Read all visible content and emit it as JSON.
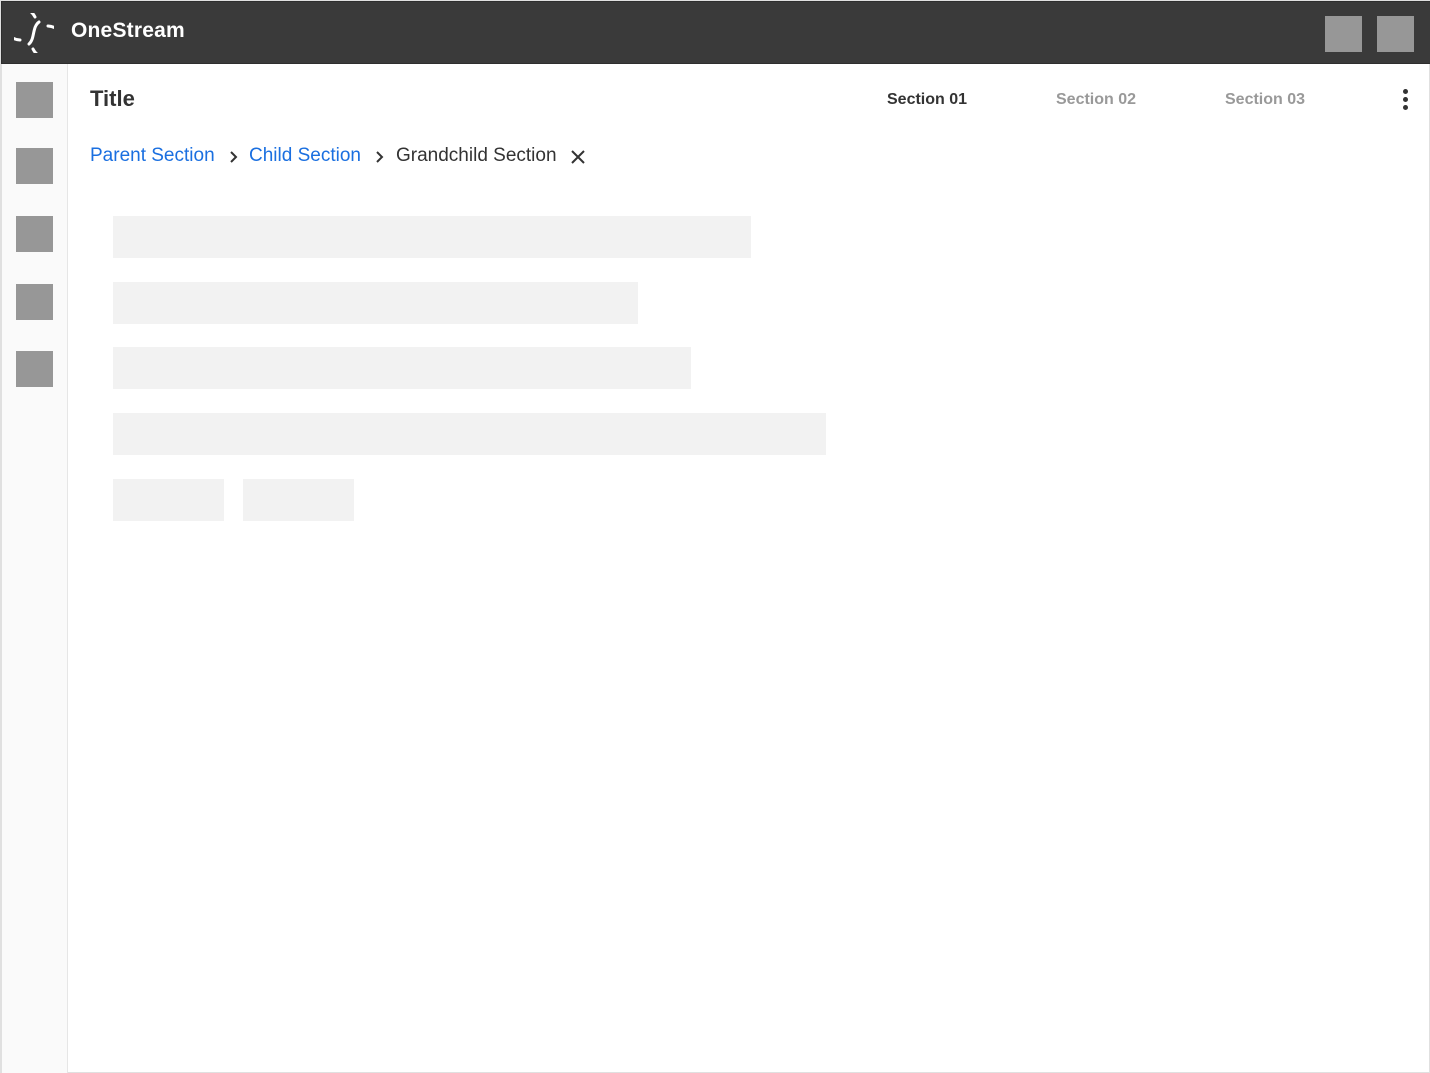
{
  "app": {
    "name": "OneStream",
    "logo_icon": "onestream-logo-icon"
  },
  "topbar": {
    "actions": [
      "placeholder-icon",
      "placeholder-icon"
    ]
  },
  "sidebar": {
    "items": [
      "placeholder-icon",
      "placeholder-icon",
      "placeholder-icon",
      "placeholder-icon",
      "placeholder-icon"
    ]
  },
  "header": {
    "title": "Title",
    "tabs": [
      {
        "label": "Section 01",
        "active": true
      },
      {
        "label": "Section 02",
        "active": false
      },
      {
        "label": "Section 03",
        "active": false
      }
    ],
    "more_icon": "kebab-menu-icon"
  },
  "breadcrumb": {
    "items": [
      {
        "label": "Parent Section",
        "link": true
      },
      {
        "label": "Child Section",
        "link": true
      },
      {
        "label": "Grandchild Section",
        "link": false
      }
    ],
    "separator_icon": "chevron-right-icon",
    "clear_icon": "close-icon"
  },
  "colors": {
    "topbar": "#3a3a3a",
    "link": "#1a6fe0",
    "placeholder": "#979797",
    "skeleton": "#f2f2f2"
  }
}
